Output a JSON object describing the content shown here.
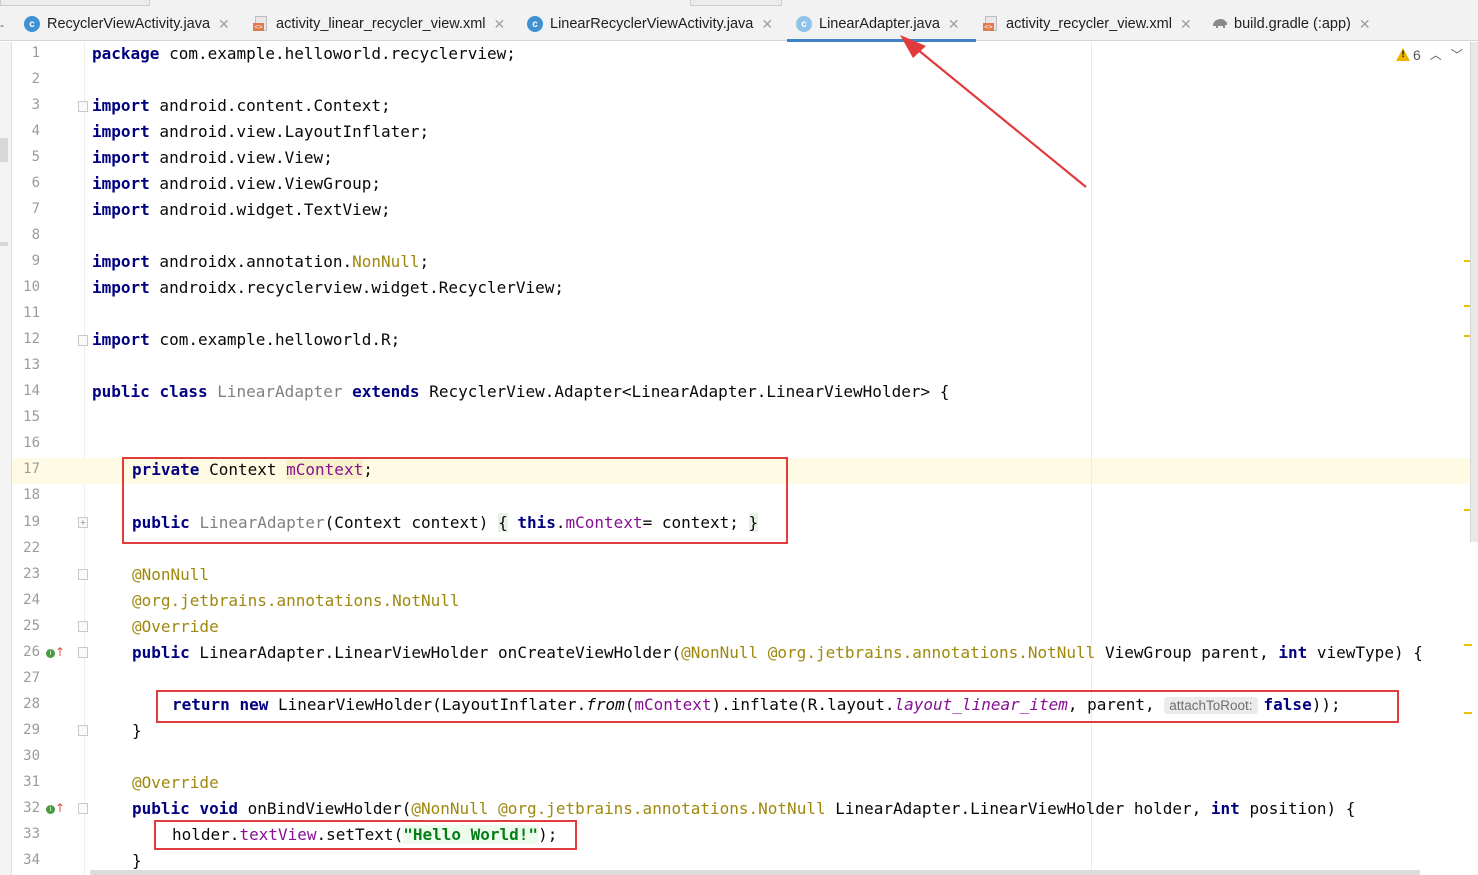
{
  "tabs": [
    {
      "label": "RecyclerViewActivity.java",
      "icon": "java-class-icon"
    },
    {
      "label": "activity_linear_recycler_view.xml",
      "icon": "xml-layout-icon"
    },
    {
      "label": "LinearRecyclerViewActivity.java",
      "icon": "java-class-icon"
    },
    {
      "label": "LinearAdapter.java",
      "icon": "java-class-icon",
      "active": true
    },
    {
      "label": "activity_recycler_view.xml",
      "icon": "xml-layout-icon"
    },
    {
      "label": "build.gradle (:app)",
      "icon": "gradle-elephant-icon"
    }
  ],
  "inspections": {
    "warnings": "6"
  },
  "editor": {
    "hint_attach": "attachToRoot:",
    "line_numbers": [
      "1",
      "2",
      "3",
      "4",
      "5",
      "6",
      "7",
      "8",
      "9",
      "10",
      "11",
      "12",
      "13",
      "14",
      "15",
      "16",
      "17",
      "18",
      "19",
      "22",
      "23",
      "24",
      "25",
      "26",
      "27",
      "28",
      "29",
      "30",
      "31",
      "32",
      "33",
      "34"
    ],
    "code": {
      "l1_kw": "package",
      "l1_rest": " com.example.helloworld.recyclerview;",
      "kw_import": "import",
      "l3": " android.content.Context;",
      "l4": " android.view.LayoutInflater;",
      "l5": " android.view.View;",
      "l6": " android.view.ViewGroup;",
      "l7": " android.widget.TextView;",
      "l9a": " androidx.annotation.",
      "l9b": "NonNull",
      "l9c": ";",
      "l10": " androidx.recyclerview.widget.RecyclerView;",
      "l12": " com.example.helloworld.R;",
      "l14_kw1": "public",
      "l14_kw2": "class",
      "l14_cls": "LinearAdapter",
      "l14_kw3": "extends",
      "l14_rest": " RecyclerView.Adapter<LinearAdapter.LinearViewHolder> {",
      "l17_kw": "private",
      "l17_type": " Context ",
      "l17_field": "mContext",
      "l17_end": ";",
      "l19_kw": "public",
      "l19_cls": "LinearAdapter",
      "l19_params": "(Context context) ",
      "l19_ob": "{",
      "l19_this": "this",
      "l19_dot": ".",
      "l19_field": "mContext",
      "l19_assign": "= context; ",
      "l19_cb": "}",
      "l23": "@NonNull",
      "l24a": "@org.jetbrains.annotations.",
      "l24b": "NotNull",
      "l25": "@Override",
      "l26_kw": "public",
      "l26a": " LinearAdapter.LinearViewHolder onCreateViewHolder(",
      "l26_ann1": "@NonNull",
      "l26_ann2": "@org.jetbrains.annotations.",
      "l26_ann3": "NotNull",
      "l26b": " ViewGroup parent, ",
      "l26_int": "int",
      "l26c": " viewType) {",
      "l28_kw1": "return",
      "l28_kw2": "new",
      "l28a": " LinearViewHolder(LayoutInflater.",
      "l28_from": "from",
      "l28b": "(",
      "l28_field": "mContext",
      "l28c": ").inflate(R.layout.",
      "l28_layout": "layout_linear_item",
      "l28d": ", parent, ",
      "l28_false": "false",
      "l28e": "));",
      "l29": "}",
      "l31": "@Override",
      "l32_kw1": "public",
      "l32_kw2": "void",
      "l32a": " onBindViewHolder(",
      "l32_ann1": "@NonNull",
      "l32_ann2": "@org.jetbrains.annotations.",
      "l32_ann3": "NotNull",
      "l32b": " LinearAdapter.LinearViewHolder holder, ",
      "l32_int": "int",
      "l32c": " position) {",
      "l33a": "holder.",
      "l33_field": "textView",
      "l33b": ".setText(",
      "l33_str": "\"Hello World!\"",
      "l33c": ");",
      "l34": "}"
    }
  },
  "colors": {
    "annotation_red": "#e23b3b",
    "tab_underline": "#4083c9",
    "keyword": "#0033b3",
    "field": "#871094",
    "string": "#067d17"
  }
}
